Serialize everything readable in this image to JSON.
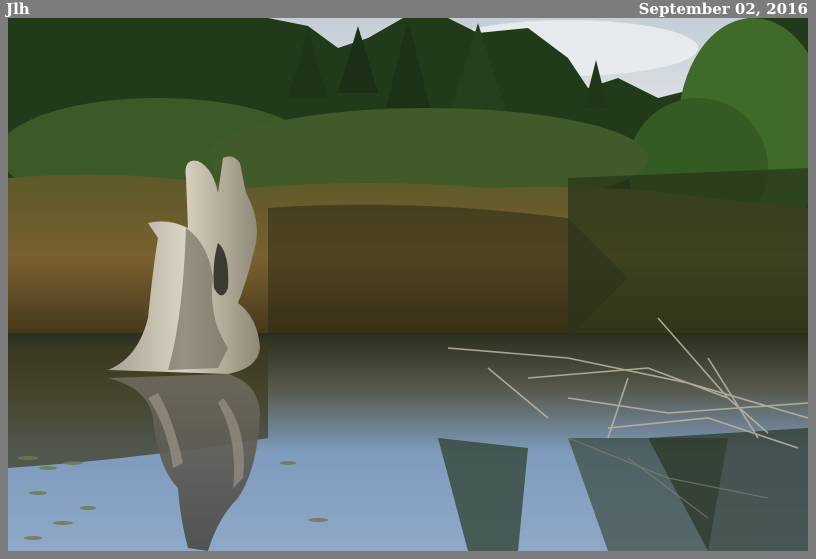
{
  "caption": {
    "initials": "Jlh",
    "date": "September 02, 2016"
  },
  "photo": {
    "subject": "weathered driftwood stump reflected in still pond water beside marsh grass and spruce forest"
  },
  "colors": {
    "frame": "#7c7c7c",
    "sky": "#c8d2dc",
    "forest": "#1f3518",
    "grass": "#6e5a2c",
    "water": "#7e99b8",
    "stump": "#c9c2b0"
  }
}
